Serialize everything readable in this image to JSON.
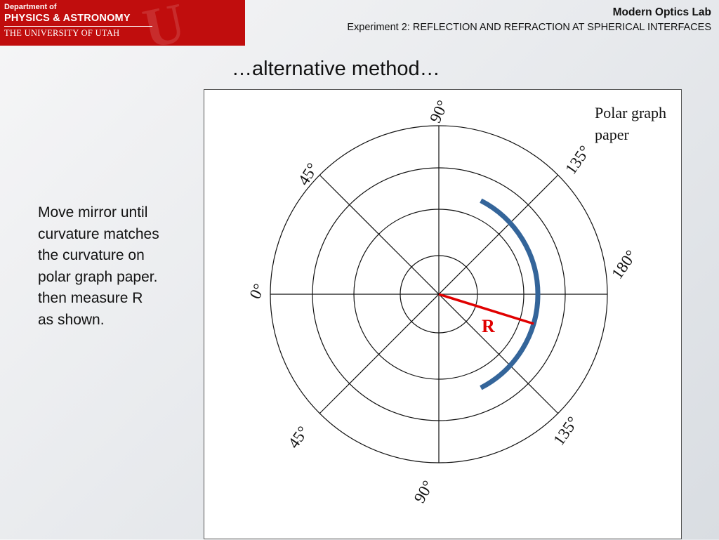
{
  "logo": {
    "line1": "Department of",
    "line2": "PHYSICS & ASTRONOMY",
    "line3": "THE UNIVERSITY OF UTAH",
    "watermark": "U"
  },
  "header": {
    "title": "Modern Optics Lab",
    "subtitle": "Experiment 2: REFLECTION AND REFRACTION AT SPHERICAL INTERFACES"
  },
  "slide": {
    "title": "…alternative method…",
    "instructions": [
      "Move mirror until",
      "curvature matches",
      "the curvature on",
      "polar graph paper.",
      "then measure R",
      "as shown."
    ]
  },
  "polar_graph": {
    "note": [
      "Polar graph",
      "paper"
    ],
    "angle_labels": {
      "top": "90°",
      "upper_left": "45°",
      "upper_right": "135°",
      "right": "180°",
      "left": "0°",
      "lower_left": "45°",
      "lower_right": "135°",
      "bottom": "90°"
    },
    "radius_label": "R"
  },
  "colors": {
    "banner": "#c00d0d",
    "mirror": "#34659a",
    "radius_line": "#e00000"
  }
}
